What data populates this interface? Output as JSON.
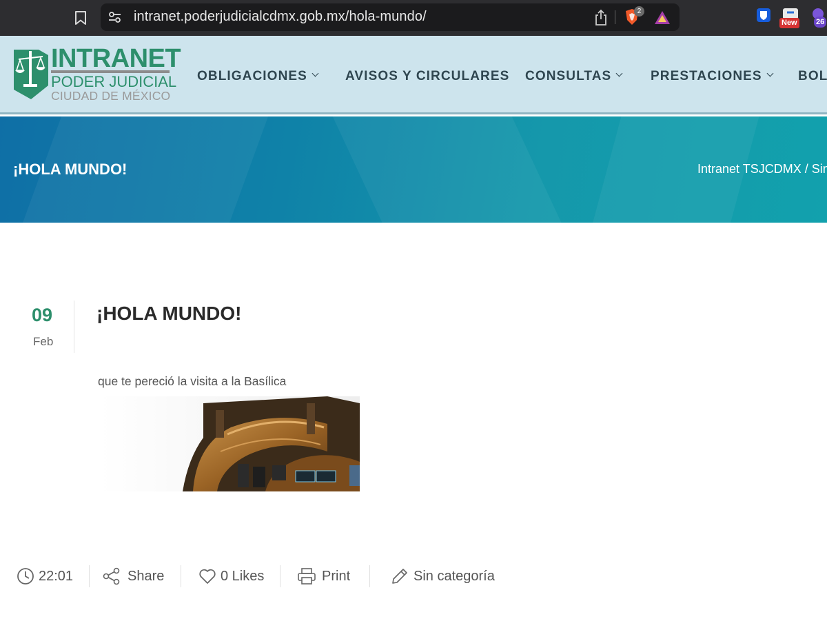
{
  "browser": {
    "url": "intranet.poderjudicialcdmx.gob.mx/hola-mundo/",
    "shield_count": "2",
    "extensions": {
      "new_badge": "New",
      "count_badge": "26"
    }
  },
  "header": {
    "logo": {
      "line1": "INTRANET",
      "line2": "PODER JUDICIAL",
      "line3": "CIUDAD DE MÉXICO"
    },
    "nav": [
      {
        "label": "OBLIGACIONES",
        "has_dropdown": true
      },
      {
        "label": "AVISOS Y CIRCULARES",
        "has_dropdown": false
      },
      {
        "label": "CONSULTAS",
        "has_dropdown": true
      },
      {
        "label": "PRESTACIONES",
        "has_dropdown": true
      },
      {
        "label": "BOL",
        "has_dropdown": false
      }
    ]
  },
  "banner": {
    "title": "¡HOLA MUNDO!",
    "breadcrumb": "Intranet TSJCDMX / Sin"
  },
  "post": {
    "day": "09",
    "month": "Feb",
    "title": "¡HOLA MUNDO!",
    "body": "que te pereció la visita a la Basílica",
    "meta": {
      "time": "22:01",
      "share": "Share",
      "likes": "0 Likes",
      "print": "Print",
      "category": "Sin categoría"
    }
  },
  "colors": {
    "brand_green": "#2d8f6c",
    "header_bg": "#cde4ed",
    "banner_start": "#0f6fa6",
    "banner_end": "#12a1ad",
    "nav_text": "#2f4650"
  }
}
